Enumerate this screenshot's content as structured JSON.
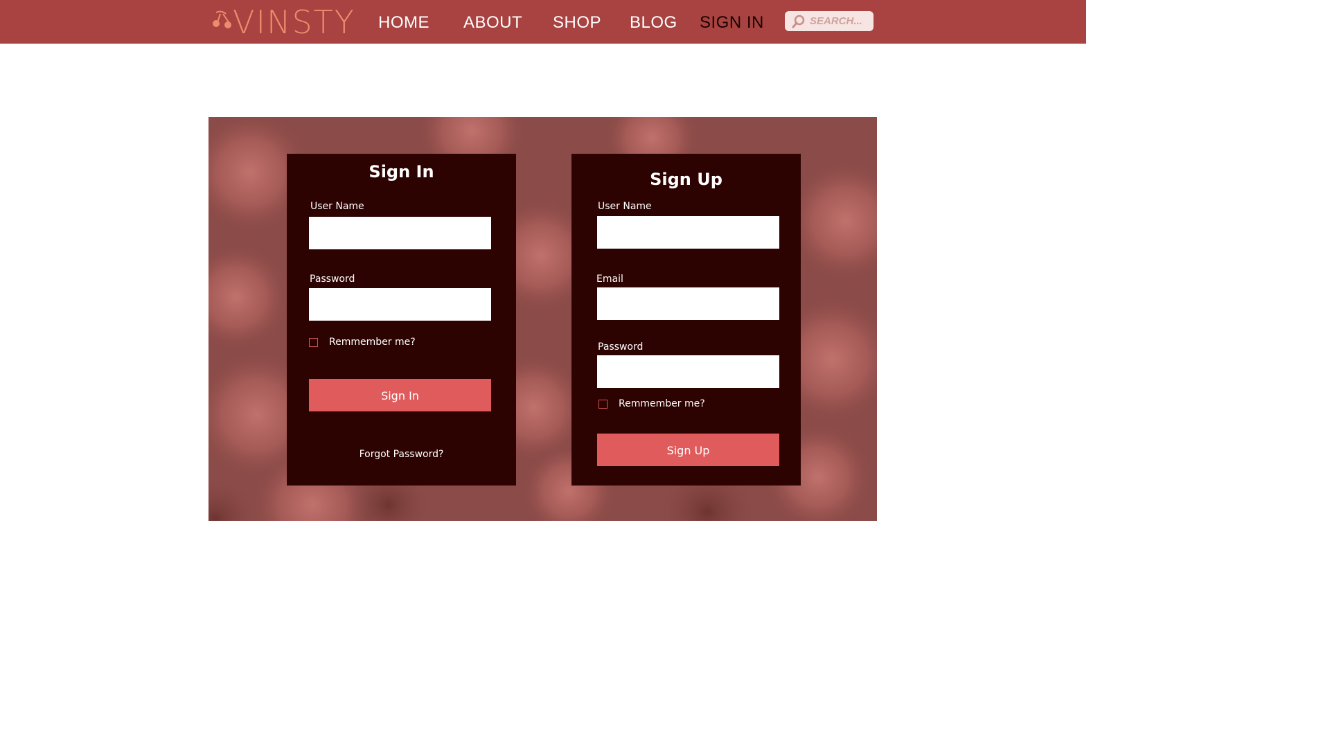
{
  "header": {
    "logo_text": "VINSTY",
    "brand_color": "#e98d6e",
    "bar_color": "#a84341",
    "nav": [
      {
        "label": "HOME",
        "active": false
      },
      {
        "label": "ABOUT",
        "active": false
      },
      {
        "label": "SHOP",
        "active": false
      },
      {
        "label": "BLOG",
        "active": false
      },
      {
        "label": "SIGN IN",
        "active": true
      }
    ],
    "search": {
      "placeholder": "SEARCH...",
      "icon": "search-icon"
    }
  },
  "hero": {
    "background": "roses-photo"
  },
  "sign_in": {
    "title": "Sign In",
    "username_label": "User Name",
    "password_label": "Password",
    "remember_label": "Remmember me?",
    "button_label": "Sign In",
    "forgot_label": "Forgot Password?"
  },
  "sign_up": {
    "title": "Sign Up",
    "username_label": "User Name",
    "email_label": "Email",
    "password_label": "Password",
    "remember_label": "Remmember me?",
    "button_label": "Sign Up"
  },
  "colors": {
    "panel": "#2d0302",
    "button": "#e05c5c",
    "checkbox_border": "#d2545a"
  }
}
